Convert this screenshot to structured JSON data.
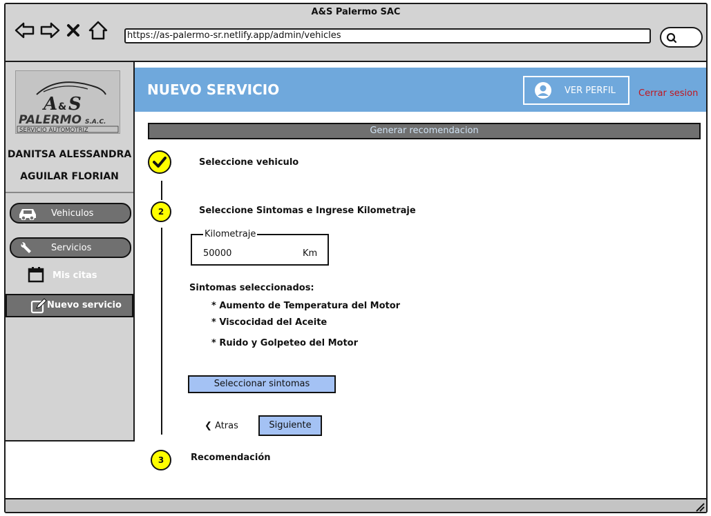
{
  "window": {
    "title": "A&S Palermo SAC"
  },
  "browser": {
    "url": "https://as-palermo-sr.netlify.app/admin/vehicles",
    "icons": [
      "back-arrow-icon",
      "forward-arrow-icon",
      "close-icon",
      "home-icon",
      "search-icon"
    ]
  },
  "logo": {
    "text_main": "A&S",
    "brand": "PALERMO",
    "suffix": "S.A.C.",
    "tagline": "SERVICIO AUTOMOTRIZ"
  },
  "user": {
    "first_line": "DANITSA ALESSANDRA",
    "second_line": "AGUILAR FLORIAN"
  },
  "sidebar": {
    "items": [
      {
        "label": "Vehiculos",
        "icon": "car-icon"
      },
      {
        "label": "Servicios",
        "icon": "wrench-icon"
      }
    ],
    "subitems": [
      {
        "label": "Mis citas",
        "icon": "calendar-icon"
      },
      {
        "label": "Nuevo servicio",
        "icon": "edit-icon",
        "active": true
      }
    ]
  },
  "header": {
    "title": "NUEVO SERVICIO",
    "profile_label": "VER PERFIL",
    "logout_label": "Cerrar sesion"
  },
  "recommendation_bar": {
    "label": "Generar recomendacion"
  },
  "steps": [
    {
      "number": "",
      "label": "Seleccione vehiculo",
      "status": "done"
    },
    {
      "number": "2",
      "label": "Seleccione Sintomas e Ingrese Kilometraje",
      "status": "active"
    },
    {
      "number": "3",
      "label": "Recomendación",
      "status": "pending"
    }
  ],
  "kilometraje": {
    "legend": "Kilometraje",
    "value": "50000",
    "unit": "Km"
  },
  "symptoms": {
    "heading": "Sintomas seleccionados:",
    "items": [
      "* Aumento de Temperatura del Motor",
      "* Viscocidad del Aceite",
      "* Ruido y Golpeteo del Motor"
    ],
    "select_button": "Seleccionar sintomas"
  },
  "navigation": {
    "back_label": "Atras",
    "next_label": "Siguiente"
  },
  "colors": {
    "header_bg": "#6fa8dc",
    "button_bg": "#a4c2f4",
    "step_yellow": "#ffff00",
    "sidebar_bg": "#d3d3d3",
    "logout_red": "#c0161f"
  }
}
